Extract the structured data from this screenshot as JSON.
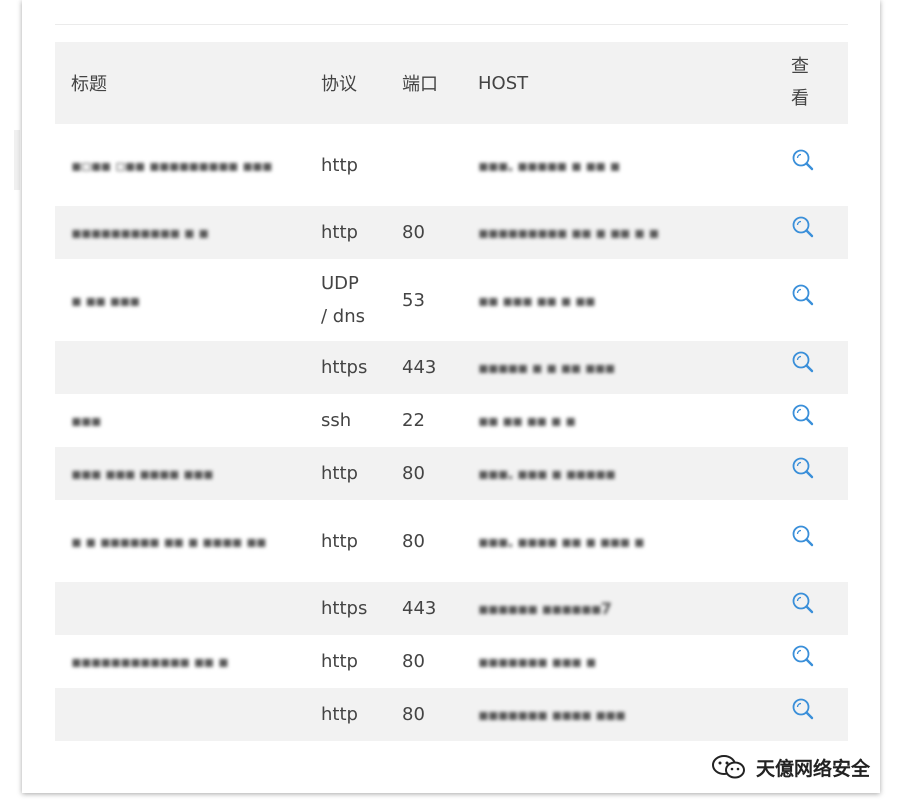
{
  "table": {
    "headers": {
      "title": "标题",
      "protocol": "协议",
      "port": "端口",
      "host": "HOST",
      "view_line1": "查",
      "view_line2": "看"
    },
    "rows": [
      {
        "title": "",
        "protocol": "http",
        "port": "",
        "host": ""
      },
      {
        "title": "",
        "protocol": "http",
        "port": "80",
        "host": ""
      },
      {
        "title": "",
        "protocol": "UDP / dns",
        "port": "53",
        "host": ""
      },
      {
        "title": "",
        "protocol": "https",
        "port": "443",
        "host": ""
      },
      {
        "title": "",
        "protocol": "ssh",
        "port": "22",
        "host": ""
      },
      {
        "title": "",
        "protocol": "http",
        "port": "80",
        "host": ""
      },
      {
        "title": "",
        "protocol": "http",
        "port": "80",
        "host": ""
      },
      {
        "title": "",
        "protocol": "https",
        "port": "443",
        "host": ""
      },
      {
        "title": "",
        "protocol": "http",
        "port": "80",
        "host": ""
      },
      {
        "title": "",
        "protocol": "http",
        "port": "80",
        "host": ""
      }
    ],
    "row_heights": [
      82,
      53,
      82,
      53,
      53,
      53,
      82,
      53,
      53,
      53
    ],
    "view_icon": "search-icon",
    "accent_color": "#3a8fd9"
  },
  "watermark": {
    "text": "天億网络安全",
    "icon": "wechat-icon"
  }
}
